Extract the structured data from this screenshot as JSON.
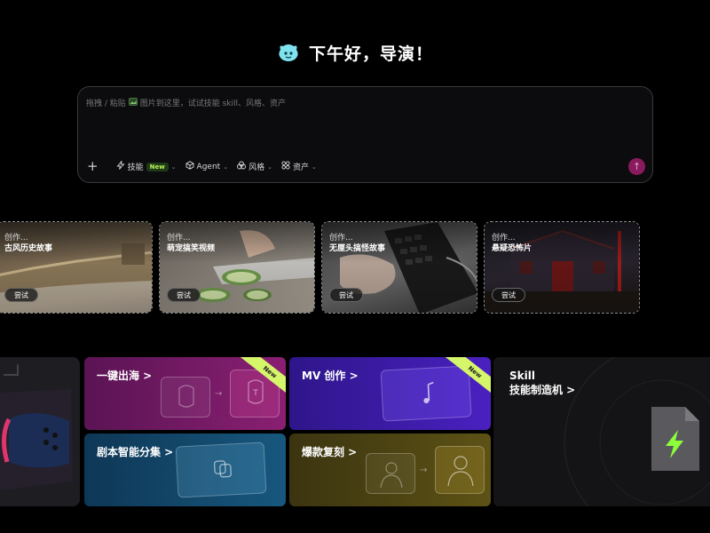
{
  "greeting": {
    "text": "下午好，导演！"
  },
  "prompt": {
    "placeholder_prefix": "拖拽 / 粘贴",
    "placeholder_suffix": "图片到这里，试试技能 skill、风格、资产"
  },
  "toolbar": {
    "plus": "+",
    "skill_label": "技能",
    "new_badge": "New",
    "agent_label": "Agent",
    "style_label": "风格",
    "assets_label": "资产",
    "send_icon": "↑"
  },
  "cards": [
    {
      "sub": "创作...",
      "title": "古风历史故事",
      "button": "尝试"
    },
    {
      "sub": "创作...",
      "title": "萌宠搞笑视频",
      "button": "尝试"
    },
    {
      "sub": "创作...",
      "title": "无厘头搞怪故事",
      "button": "尝试"
    },
    {
      "sub": "创作...",
      "title": "悬疑恐怖片",
      "button": "尝试"
    }
  ],
  "tiles": {
    "oversea": {
      "title": "一键出海 >",
      "badge": "New"
    },
    "mv": {
      "title": "MV 创作 >",
      "badge": "New"
    },
    "script": {
      "title": "剧本智能分集 >"
    },
    "viral": {
      "title": "爆款复刻 >"
    },
    "skill": {
      "line1": "Skill",
      "line2": "技能制造机 >"
    }
  },
  "colors": {
    "send": "#8a1a5e",
    "oversea_tile": "#7a1a66",
    "mv_tile": "#3f1aa8",
    "script_tile": "#134a6e",
    "viral_tile": "#4f4410",
    "new_badge": "#d5f56b"
  }
}
